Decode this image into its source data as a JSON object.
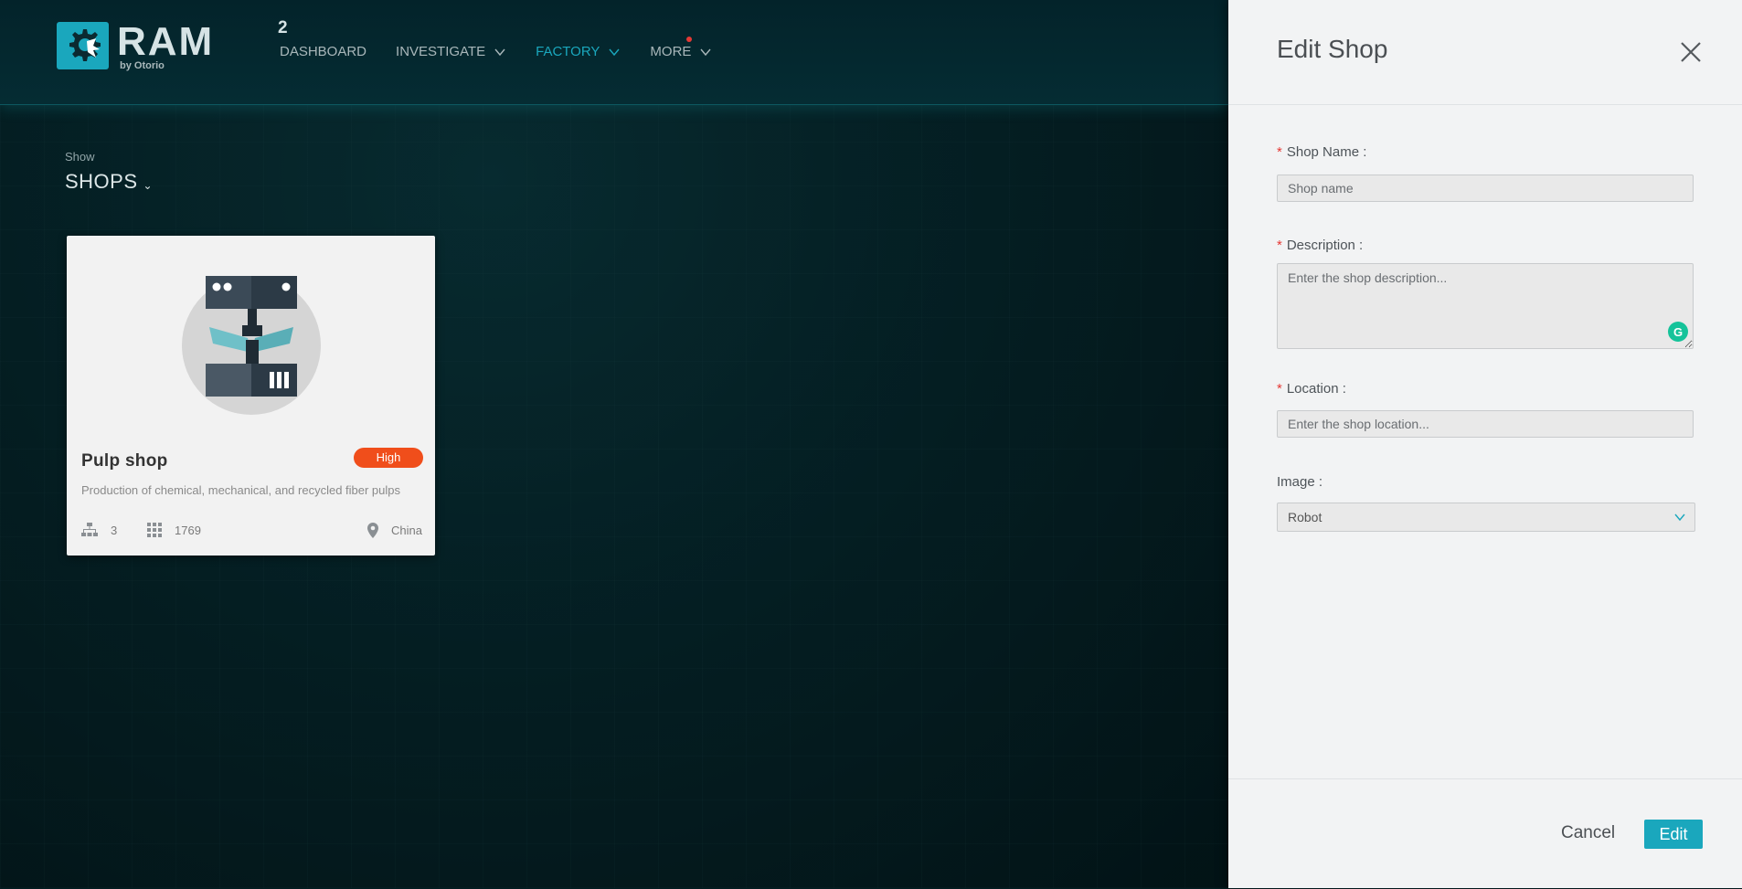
{
  "brand": {
    "name": "RAM",
    "superscript": "2",
    "byline": "by Otorio"
  },
  "nav": {
    "items": [
      {
        "label": "DASHBOARD",
        "has_dropdown": false,
        "active": false
      },
      {
        "label": "INVESTIGATE",
        "has_dropdown": true,
        "active": false
      },
      {
        "label": "FACTORY",
        "has_dropdown": true,
        "active": true
      },
      {
        "label": "MORE",
        "has_dropdown": true,
        "active": false,
        "notification_dot": true
      }
    ]
  },
  "view": {
    "show_label": "Show",
    "selected": "SHOPS"
  },
  "shop_card": {
    "title": "Pulp shop",
    "badge": "High",
    "description": "Production of chemical, mechanical, and recycled fiber pulps",
    "stats": {
      "hierarchy_count": "3",
      "assets_count": "1769",
      "location": "China"
    },
    "image_icon": "robot-illustration"
  },
  "drawer": {
    "title": "Edit Shop",
    "fields": {
      "shop_name": {
        "label": "Shop Name",
        "colon": ":",
        "required": true,
        "value": "",
        "placeholder": "Shop name"
      },
      "description": {
        "label": "Description",
        "colon": ":",
        "required": true,
        "value": "",
        "placeholder": "Enter the shop description..."
      },
      "location": {
        "label": "Location",
        "colon": ":",
        "required": true,
        "value": "",
        "placeholder": "Enter the shop location..."
      },
      "image": {
        "label": "Image",
        "colon": ":",
        "required": false,
        "value": "Robot"
      }
    },
    "cancel_label": "Cancel",
    "submit_label": "Edit"
  },
  "colors": {
    "accent": "#1aa7bd",
    "badge_high": "#f04e1b",
    "required": "#e53935"
  }
}
